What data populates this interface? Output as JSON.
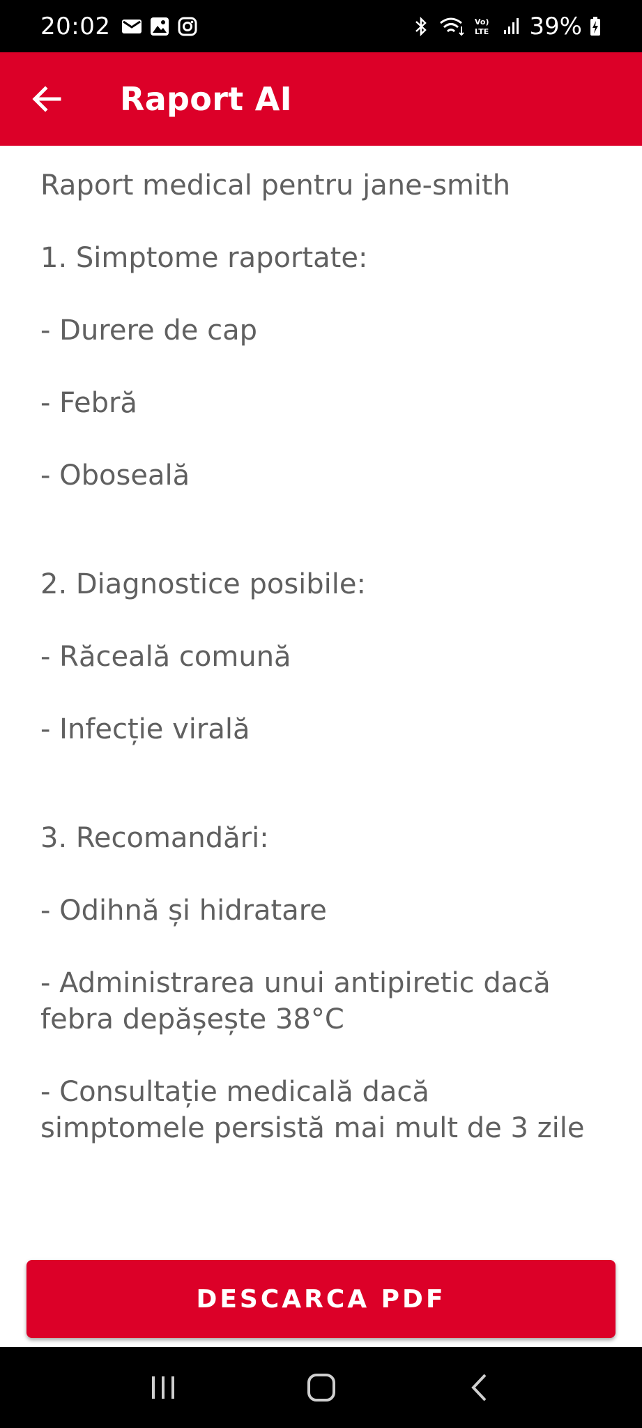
{
  "status_bar": {
    "time": "20:02",
    "battery": "39%",
    "left_icons": [
      "mail-icon",
      "gallery-icon",
      "instagram-icon"
    ],
    "right_icons": [
      "bluetooth-icon",
      "wifi-icon",
      "volte-icon",
      "signal-icon",
      "battery-charging-icon"
    ]
  },
  "app_bar": {
    "title": "Raport AI",
    "back_icon": "arrow-left-icon",
    "background": "#dc0028"
  },
  "report": {
    "heading": "Raport medical pentru jane-smith",
    "sections": [
      {
        "title": "1. Simptome raportate:",
        "items": [
          "- Durere de cap",
          "- Febră",
          "- Oboseală"
        ]
      },
      {
        "title": "2. Diagnostice posibile:",
        "items": [
          "- Răceală comună",
          "- Infecție virală"
        ]
      },
      {
        "title": "3. Recomandări:",
        "items": [
          "- Odihnă și hidratare",
          "- Administrarea unui antipiretic dacă febra depășește 38°C",
          "- Consultație medicală dacă simptomele persistă mai mult de 3 zile"
        ]
      }
    ]
  },
  "download_button": {
    "label": "DESCARCA PDF"
  },
  "nav_bar": {
    "buttons": [
      "recent-apps-icon",
      "home-icon",
      "back-icon"
    ]
  }
}
